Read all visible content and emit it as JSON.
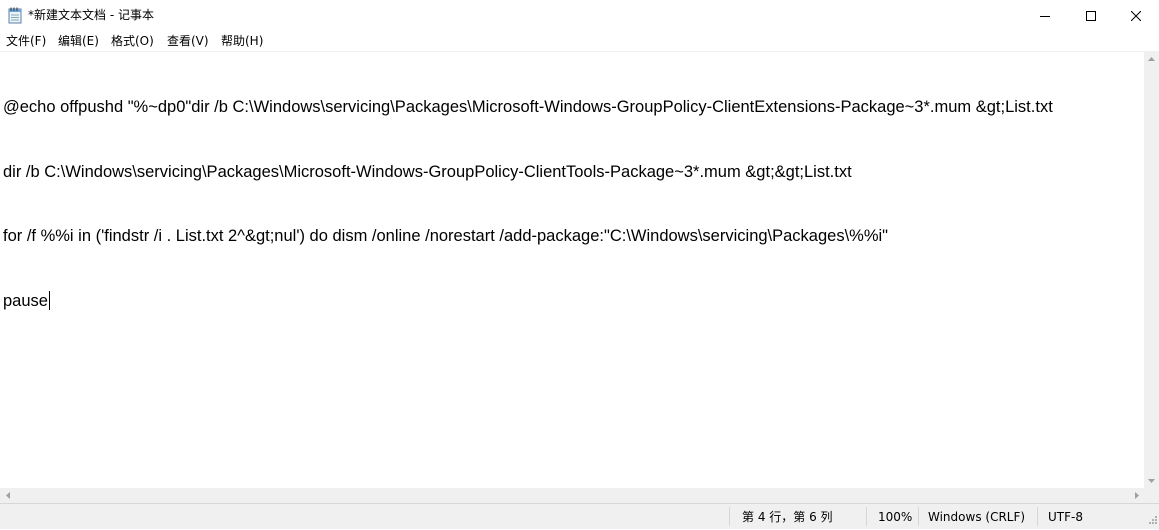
{
  "window": {
    "title": "*新建文本文档 - 记事本",
    "icon": "notepad-icon",
    "controls": [
      "minimize-icon",
      "maximize-icon",
      "close-icon"
    ]
  },
  "menu": {
    "items": [
      {
        "label": "文件(F)"
      },
      {
        "label": "编辑(E)"
      },
      {
        "label": "格式(O)"
      },
      {
        "label": "查看(V)"
      },
      {
        "label": "帮助(H)"
      }
    ]
  },
  "editor": {
    "lines": [
      "@echo offpushd \"%~dp0\"dir /b C:\\Windows\\servicing\\Packages\\Microsoft-Windows-GroupPolicy-ClientExtensions-Package~3*.mum &gt;List.txt",
      "dir /b C:\\Windows\\servicing\\Packages\\Microsoft-Windows-GroupPolicy-ClientTools-Package~3*.mum &gt;&gt;List.txt",
      "for /f %%i in ('findstr /i . List.txt 2^&gt;nul') do dism /online /norestart /add-package:\"C:\\Windows\\servicing\\Packages\\%%i\"",
      "pause"
    ]
  },
  "statusbar": {
    "position": "第 4 行，第 6 列",
    "zoom": "100%",
    "line_ending": "Windows (CRLF)",
    "encoding": "UTF-8"
  },
  "colors": {
    "chrome": "#f0f0f0",
    "background": "#ffffff",
    "text": "#000000"
  }
}
